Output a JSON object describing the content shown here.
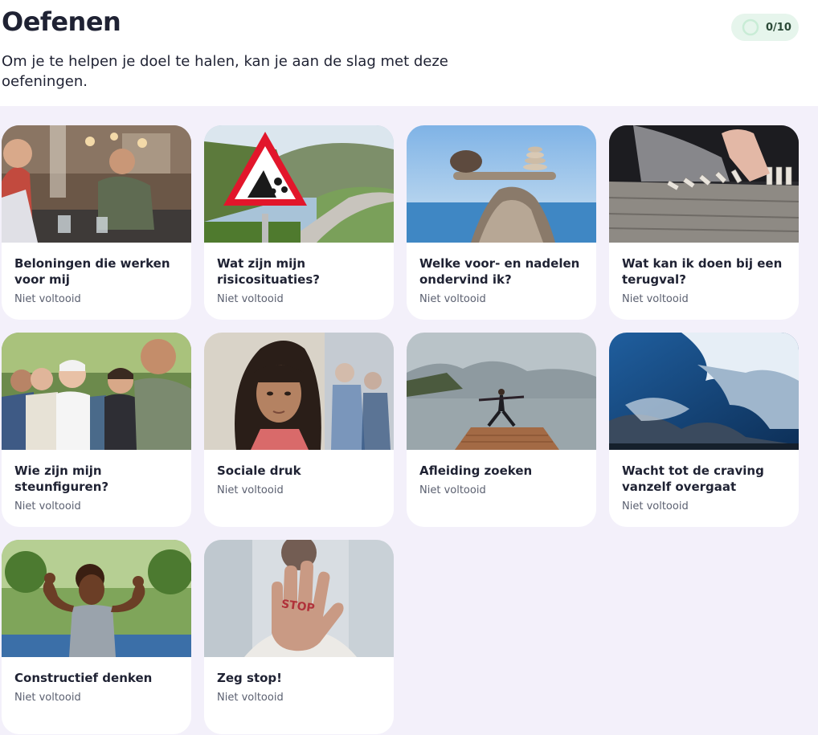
{
  "header": {
    "title": "Oefenen",
    "subtitle": "Om je te helpen je doel te halen, kan je aan de slag met deze oefeningen.",
    "progress": {
      "label": "0/10",
      "completed": 0,
      "total": 10,
      "accent": "#4fb77e"
    }
  },
  "exercises": [
    {
      "title": "Beloningen die werken voor mij",
      "status": "Niet voltooid",
      "image": "cafe-conversation"
    },
    {
      "title": "Wat zijn mijn risicosituaties?",
      "status": "Niet voltooid",
      "image": "falling-rocks-sign"
    },
    {
      "title": "Welke voor- en nadelen ondervind ik?",
      "status": "Niet voltooid",
      "image": "balancing-stones"
    },
    {
      "title": "Wat kan ik doen bij een terugval?",
      "status": "Niet voltooid",
      "image": "dominoes"
    },
    {
      "title": "Wie zijn mijn steunfiguren?",
      "status": "Niet voltooid",
      "image": "group-of-friends"
    },
    {
      "title": "Sociale druk",
      "status": "Niet voltooid",
      "image": "woman-in-crowd"
    },
    {
      "title": "Afleiding zoeken",
      "status": "Niet voltooid",
      "image": "yoga-on-pier"
    },
    {
      "title": "Wacht tot de craving vanzelf overgaat",
      "status": "Niet voltooid",
      "image": "clouds-sky"
    },
    {
      "title": "Constructief denken",
      "status": "Niet voltooid",
      "image": "strong-woman"
    },
    {
      "title": "Zeg stop!",
      "status": "Niet voltooid",
      "image": "stop-hand"
    }
  ],
  "colors": {
    "page_background": "#f3f0fa",
    "card": "#ffffff",
    "text": "#1f2233",
    "muted": "#5b6070",
    "progress_bg": "#e6f5ec"
  }
}
